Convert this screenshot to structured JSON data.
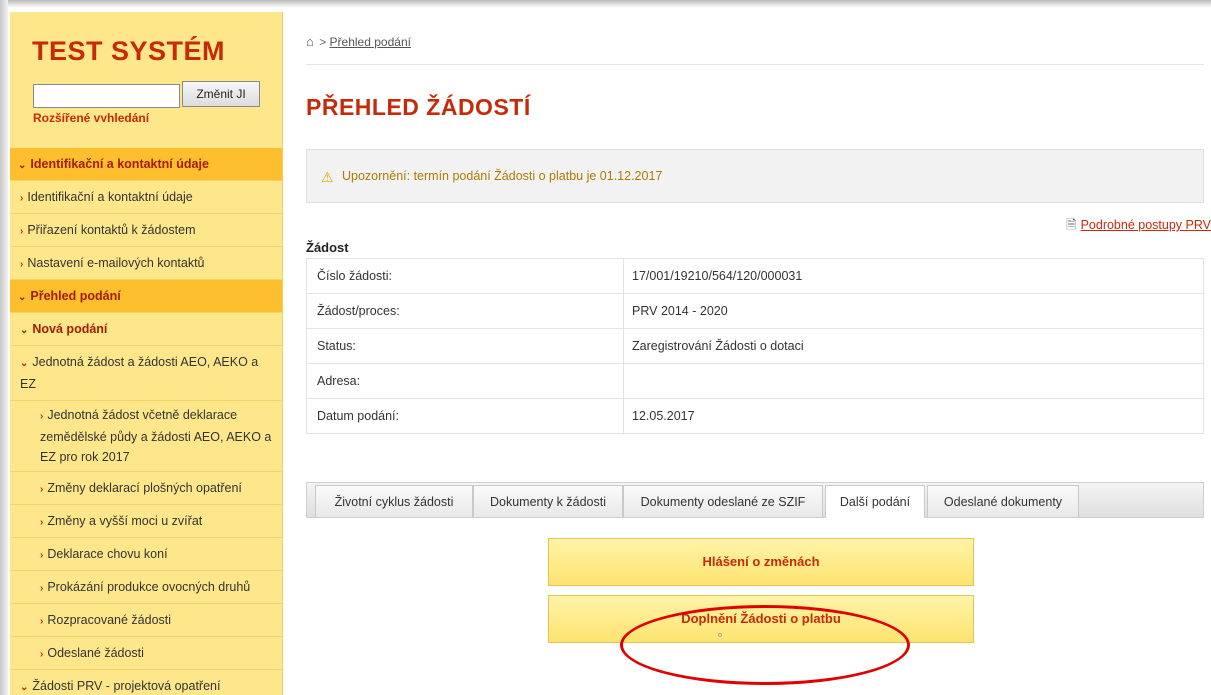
{
  "sidebar": {
    "logo": "TEST SYSTÉM",
    "search_value": "",
    "change_button": "Změnit JI",
    "advanced_search": "Rozšířené vyhledání",
    "menu": [
      {
        "label": "Identifikační a kontaktní údaje"
      },
      {
        "label": "Identifikační a kontaktní údaje"
      },
      {
        "label": "Přiřazení kontaktů k žádostem"
      },
      {
        "label": "Nastavení e-mailových kontaktů"
      },
      {
        "label": "Přehled podání"
      },
      {
        "label": "Nová podání"
      },
      {
        "label": "Jednotná žádost a žádosti AEO, AEKO a EZ"
      },
      {
        "label": "Jednotná žádost včetně deklarace zemědělské půdy a žádosti AEO, AEKO a EZ pro rok 2017"
      },
      {
        "label": "Změny deklarací plošných opatření"
      },
      {
        "label": "Změny a vyšší moci u zvířat"
      },
      {
        "label": "Deklarace chovu koní"
      },
      {
        "label": "Prokázání produkce ovocných druhů"
      },
      {
        "label": "Rozpracované žádosti"
      },
      {
        "label": "Odeslané žádosti"
      },
      {
        "label": "Žádosti PRV - projektová opatření"
      }
    ]
  },
  "breadcrumb": {
    "current": "Přehled podání"
  },
  "page_title": "PŘEHLED ŽÁDOSTÍ",
  "notice": "Upozornění: termín podání Žádosti o platbu je 01.12.2017",
  "prv_link": "Podrobné postupy PRV",
  "section_label": "Žádost",
  "info": [
    {
      "key": "Číslo žádosti:",
      "value": "17/001/19210/564/120/000031"
    },
    {
      "key": "Žádost/proces:",
      "value": "PRV 2014 - 2020"
    },
    {
      "key": "Status:",
      "value": "Zaregistrování Žádosti o dotaci"
    },
    {
      "key": "Adresa:",
      "value": ""
    },
    {
      "key": "Datum podání:",
      "value": "12.05.2017"
    }
  ],
  "tabs": [
    {
      "label": "Životní cyklus žádosti"
    },
    {
      "label": "Dokumenty k žádosti"
    },
    {
      "label": "Dokumenty odeslané ze SZIF"
    },
    {
      "label": "Další podání"
    },
    {
      "label": "Odeslané dokumenty"
    }
  ],
  "actions": {
    "report_changes": "Hlášení o změnách",
    "supplement_payment": "Doplnění Žádosti o platbu"
  },
  "colors": {
    "accent": "#c52b0a",
    "sidebar_bg": "#fee78a",
    "section_bg": "#fdbf2d",
    "highlight_oval": "#e00000"
  }
}
